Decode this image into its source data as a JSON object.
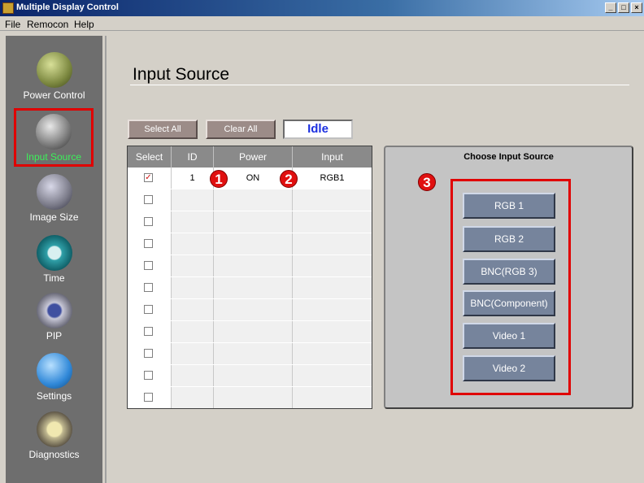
{
  "window": {
    "title": "Multiple Display Control",
    "min": "_",
    "max": "□",
    "close": "×"
  },
  "menu": [
    "File",
    "Remocon",
    "Help"
  ],
  "sidebar": {
    "items": [
      {
        "label": "Power Control",
        "icon": "power-plug-icon",
        "active": false
      },
      {
        "label": "Input Source",
        "icon": "cable-connector-icon",
        "active": true
      },
      {
        "label": "Image Size",
        "icon": "image-size-icon",
        "active": false
      },
      {
        "label": "Time",
        "icon": "clock-icon",
        "active": false
      },
      {
        "label": "PIP",
        "icon": "pip-screen-icon",
        "active": false
      },
      {
        "label": "Settings",
        "icon": "wrench-settings-icon",
        "active": false
      },
      {
        "label": "Diagnostics",
        "icon": "checklist-icon",
        "active": false
      }
    ]
  },
  "main": {
    "title": "Input Source",
    "buttons": {
      "select_all": "Select All",
      "clear_all": "Clear All"
    },
    "status": "Idle"
  },
  "table": {
    "headers": [
      "Select",
      "ID",
      "Power",
      "Input"
    ],
    "rows": [
      {
        "checked": true,
        "id": "1",
        "power": "ON",
        "input": "RGB1"
      },
      {
        "checked": false,
        "id": "",
        "power": "",
        "input": ""
      },
      {
        "checked": false,
        "id": "",
        "power": "",
        "input": ""
      },
      {
        "checked": false,
        "id": "",
        "power": "",
        "input": ""
      },
      {
        "checked": false,
        "id": "",
        "power": "",
        "input": ""
      },
      {
        "checked": false,
        "id": "",
        "power": "",
        "input": ""
      },
      {
        "checked": false,
        "id": "",
        "power": "",
        "input": ""
      },
      {
        "checked": false,
        "id": "",
        "power": "",
        "input": ""
      },
      {
        "checked": false,
        "id": "",
        "power": "",
        "input": ""
      },
      {
        "checked": false,
        "id": "",
        "power": "",
        "input": ""
      },
      {
        "checked": false,
        "id": "",
        "power": "",
        "input": ""
      }
    ]
  },
  "panel": {
    "title": "Choose Input Source",
    "sources": [
      "RGB 1",
      "RGB 2",
      "BNC(RGB 3)",
      "BNC(Component)",
      "Video 1",
      "Video 2"
    ]
  },
  "markers": [
    "1",
    "2",
    "3"
  ],
  "colors": {
    "highlight": "#e00000",
    "active_label": "#3cf05a",
    "status_text": "#1c30e0"
  }
}
